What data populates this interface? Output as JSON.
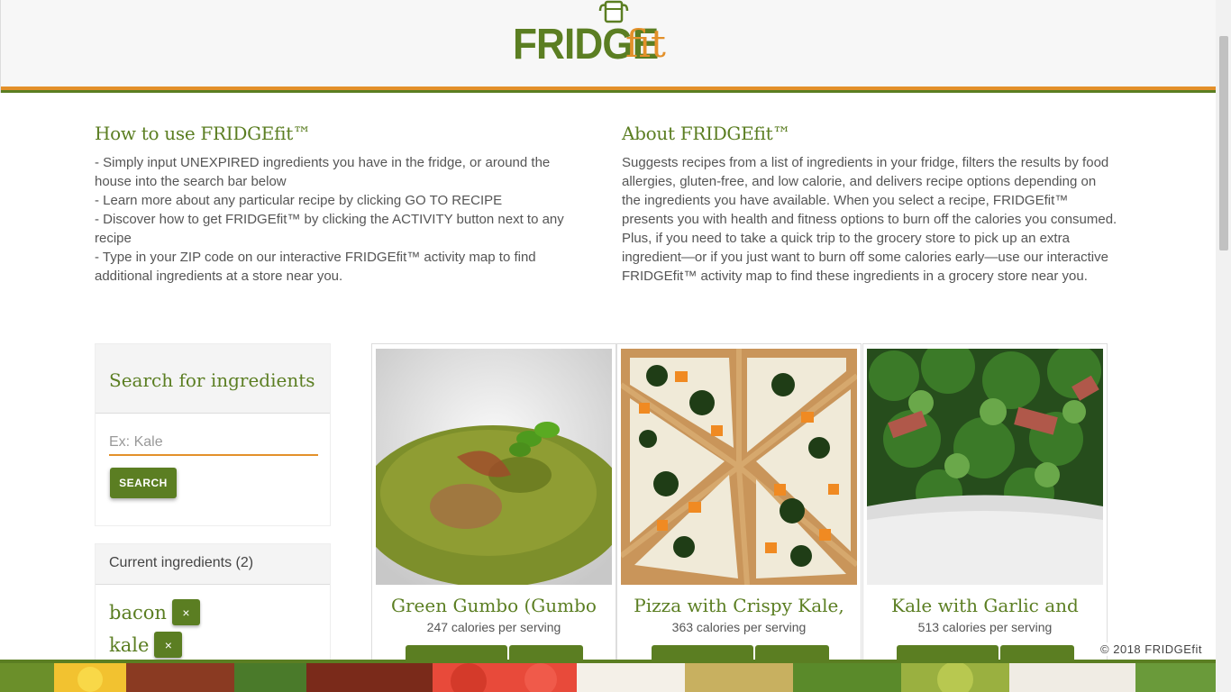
{
  "brand": {
    "name_part1": "FRIDGE",
    "name_part2": "fit",
    "colors": {
      "green": "#5b7e22",
      "orange": "#e3902a"
    }
  },
  "how_to": {
    "title": "How to use FRIDGEfit™",
    "text": "- Simply input UNEXPIRED ingredients you have in the fridge, or around the house into the search bar below\n- Learn more about any particular recipe by clicking GO TO RECIPE\n- Discover how to get FRIDGEfit™ by clicking the ACTIVITY button next to any recipe\n- Type in your ZIP code on our interactive FRIDGEfit™ activity map to find additional ingredients at a store near you."
  },
  "about": {
    "title": "About FRIDGEfit™",
    "text": "Suggests recipes from a list of ingredients in your fridge, filters the results by food allergies, gluten-free, and low calorie, and delivers recipe options depending on the ingredients you have available. When you select a recipe, FRIDGEfit™ presents you with health and fitness options to burn off the calories you consumed. Plus, if you need to take a quick trip to the grocery store to pick up an extra ingredient—or if you just want to burn off some calories early—use our interactive FRIDGEfit™ activity map to find these ingredients in a grocery store near you."
  },
  "search": {
    "title": "Search for ingredients",
    "placeholder": "Ex: Kale",
    "button_label": "SEARCH"
  },
  "current": {
    "title": "Current ingredients (2)",
    "items": [
      {
        "name": "bacon",
        "remove_label": "×"
      },
      {
        "name": "kale",
        "remove_label": "×"
      }
    ]
  },
  "recipes": [
    {
      "title": "Green Gumbo (Gumbo",
      "calories": "247 calories per serving",
      "image": "green gumbo dish"
    },
    {
      "title": "Pizza with Crispy Kale,",
      "calories": "363 calories per serving",
      "image": "kale squash pizza"
    },
    {
      "title": "Kale with Garlic and",
      "calories": "513 calories per serving",
      "image": "kale and bacon bowl"
    }
  ],
  "footer": {
    "copyright": "© 2018 FRIDGEfit"
  }
}
